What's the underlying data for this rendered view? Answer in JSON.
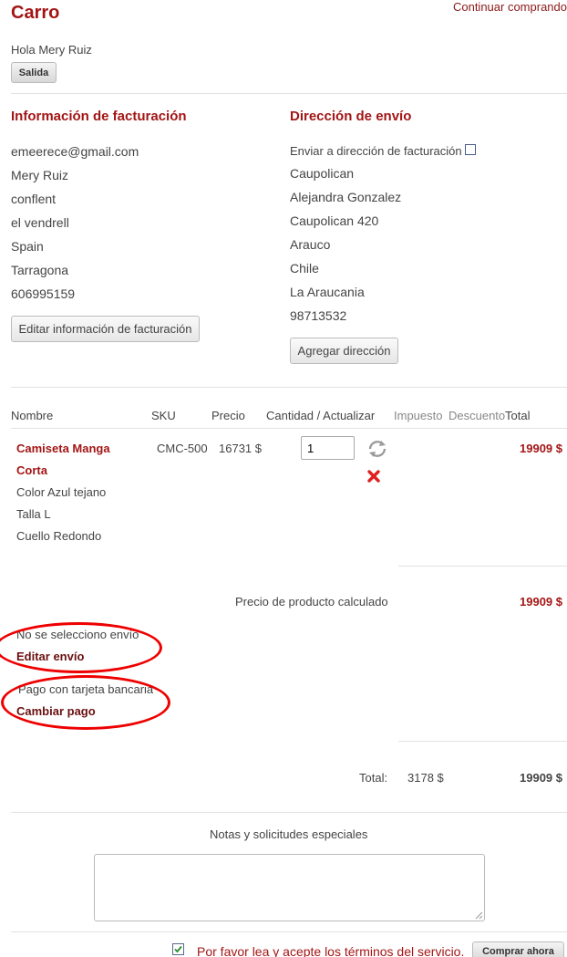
{
  "header": {
    "title": "Carro",
    "continue_link": "Continuar comprando",
    "greeting": "Hola Mery Ruiz",
    "logout_label": "Salida"
  },
  "billing": {
    "heading": "Información de facturación",
    "lines": [
      "emeerece@gmail.com",
      "Mery Ruiz",
      "conflent",
      "el vendrell",
      "Spain",
      "Tarragona",
      "606995159"
    ],
    "edit_label": "Editar información de facturación"
  },
  "shipping": {
    "heading": "Dirección de envío",
    "same_as_billing_label": "Enviar a dirección de facturación",
    "lines": [
      "Caupolican",
      "Alejandra Gonzalez",
      "Caupolican 420",
      "Arauco",
      "Chile",
      "La Araucania",
      "98713532"
    ],
    "add_label": "Agregar dirección"
  },
  "table": {
    "headers": {
      "name": "Nombre",
      "sku": "SKU",
      "price": "Precio",
      "qty": "Cantidad / Actualizar",
      "tax": "Impuesto",
      "discount": "Descuento",
      "total": "Total"
    },
    "item": {
      "name_line1": "Camiseta Manga",
      "name_line2": "Corta",
      "options": [
        "Color Azul tejano",
        "Talla L",
        "Cuello Redondo"
      ],
      "sku": "CMC-500",
      "price": "16731 $",
      "qty": "1",
      "total": "19909 $"
    }
  },
  "summary": {
    "calc_label": "Precio de producto calculado",
    "calc_value": "19909 $",
    "shipping_status": "No se selecciono envío",
    "edit_shipping": "Editar envío",
    "payment_status": "Pago con tarjeta bancaria",
    "change_payment": "Cambiar pago",
    "total_label": "Total:",
    "total_tax": "3178 $",
    "total_value": "19909 $"
  },
  "notes": {
    "label": "Notas y solicitudes especiales"
  },
  "footer": {
    "terms_label": "Por favor lea y acepte los términos del servicio.",
    "buy_label": "Comprar ahora"
  },
  "colors": {
    "accent": "#a31515",
    "annotation": "#e00000"
  }
}
